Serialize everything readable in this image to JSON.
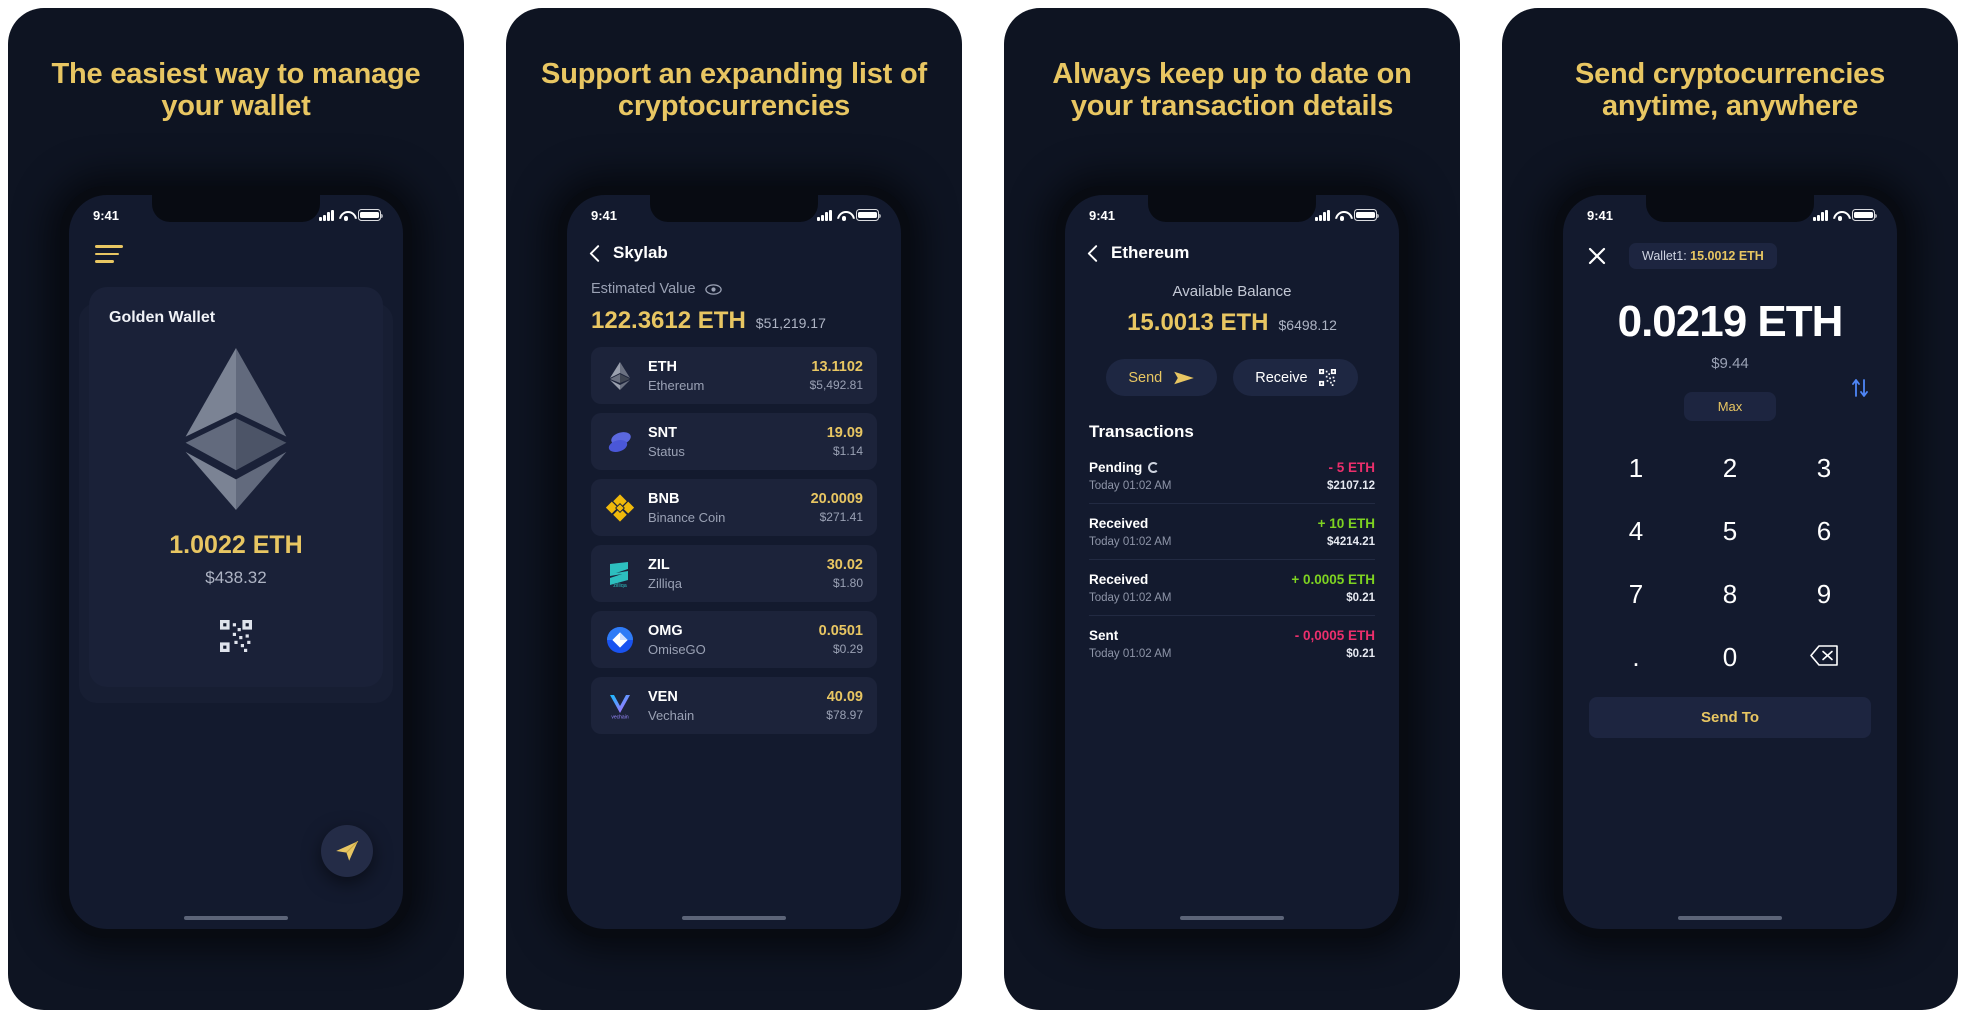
{
  "panels": [
    {
      "headline": "The easiest way to manage your wallet",
      "status": {
        "time": "9:41"
      },
      "wallet": {
        "name": "Golden Wallet",
        "balance_eth": "1.0022 ETH",
        "balance_usd": "$438.32"
      },
      "icons": {
        "menu": "hamburger-menu-icon",
        "qr": "qr-code-icon",
        "send": "paper-plane-icon",
        "coin": "ethereum-logo"
      }
    },
    {
      "headline": "Support an expanding list of cryptocurrencies",
      "status": {
        "time": "9:41"
      },
      "nav": {
        "back": "chevron-left-icon",
        "title": "Skylab"
      },
      "estimated": {
        "label": "Estimated Value",
        "eye_icon": "eye-icon",
        "value": "122.3612 ETH",
        "usd": "$51,219.17"
      },
      "coins": [
        {
          "symbol": "ETH",
          "name": "Ethereum",
          "amount": "13.1102",
          "usd": "$5,492.81",
          "icon": "ethereum-coin-icon",
          "color": "#8a8f9c"
        },
        {
          "symbol": "SNT",
          "name": "Status",
          "amount": "19.09",
          "usd": "$1.14",
          "icon": "status-coin-icon",
          "color": "#5b68df"
        },
        {
          "symbol": "BNB",
          "name": "Binance Coin",
          "amount": "20.0009",
          "usd": "$271.41",
          "icon": "binance-coin-icon",
          "color": "#f0b90b"
        },
        {
          "symbol": "ZIL",
          "name": "Zilliqa",
          "amount": "30.02",
          "usd": "$1.80",
          "icon": "zilliqa-coin-icon",
          "color": "#2dbfbf"
        },
        {
          "symbol": "OMG",
          "name": "OmiseGO",
          "amount": "0.0501",
          "usd": "$0.29",
          "icon": "omisego-coin-icon",
          "color": "#1a53f0"
        },
        {
          "symbol": "VEN",
          "name": "Vechain",
          "amount": "40.09",
          "usd": "$78.97",
          "icon": "vechain-coin-icon",
          "color": "#15bdff"
        }
      ]
    },
    {
      "headline": "Always keep up to date on your transaction details",
      "status": {
        "time": "9:41"
      },
      "nav": {
        "back": "chevron-left-icon",
        "title": "Ethereum"
      },
      "available": {
        "label": "Available Balance",
        "eth": "15.0013 ETH",
        "usd": "$6498.12"
      },
      "actions": {
        "send": "Send",
        "receive": "Receive",
        "send_icon": "paper-plane-icon",
        "receive_icon": "qr-code-icon"
      },
      "transactions_title": "Transactions",
      "transactions": [
        {
          "status": "Pending",
          "pending": true,
          "date": "Today 01:02 AM",
          "amount": "- 5 ETH",
          "usd": "$2107.12",
          "color": "#ec2f6c"
        },
        {
          "status": "Received",
          "pending": false,
          "date": "Today 01:02 AM",
          "amount": "+ 10 ETH",
          "usd": "$4214.21",
          "color": "#7ed321"
        },
        {
          "status": "Received",
          "pending": false,
          "date": "Today 01:02 AM",
          "amount": "+ 0.0005 ETH",
          "usd": "$0.21",
          "color": "#7ed321"
        },
        {
          "status": "Sent",
          "pending": false,
          "date": "Today 01:02 AM",
          "amount": "- 0,0005 ETH",
          "usd": "$0.21",
          "color": "#ec2f6c"
        }
      ]
    },
    {
      "headline": "Send cryptocurrencies anytime, anywhere",
      "status": {
        "time": "9:41"
      },
      "close_icon": "close-x-icon",
      "wallet_pill": {
        "label": "Wallet1: ",
        "value": "15.0012 ETH"
      },
      "amount": "0.0219 ETH",
      "amount_usd": "$9.44",
      "swap_icon": "swap-vertical-icon",
      "max_label": "Max",
      "keys": [
        "1",
        "2",
        "3",
        "4",
        "5",
        "6",
        "7",
        "8",
        "9",
        ".",
        "0",
        "backspace-icon"
      ],
      "send_to_label": "Send To"
    }
  ],
  "theme": {
    "panel_bg": "#0e1422",
    "screen_bg": "#131a2e",
    "gold": "#e8c662",
    "card": "#1c233a",
    "muted": "#9aa1b4",
    "green": "#7ed321",
    "red": "#ec2f6c"
  }
}
